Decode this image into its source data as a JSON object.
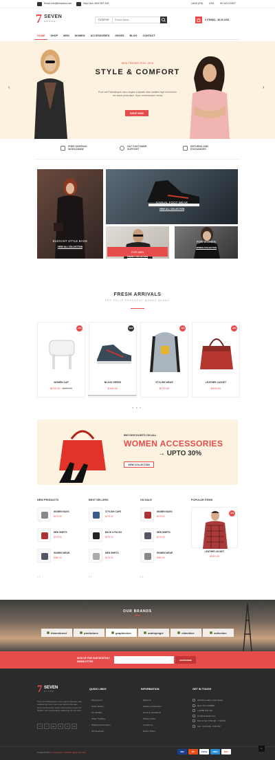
{
  "topbar": {
    "email": "Email: info@templaza.com",
    "phone": "Help Line: 0800 567 345",
    "language": "LANG (EN)",
    "currency": "USD",
    "account": "MY ACCOUNT"
  },
  "header": {
    "logo_mark": "7",
    "logo_name": "SEVEN",
    "logo_sub": "STORE",
    "filter_label": "FILTER BY",
    "search_placeholder": "Product Name...",
    "cart_label": "0 ITEM(S) - $0.00 USD"
  },
  "nav": [
    "HOME",
    "SHOP",
    "MEN",
    "WOMEN",
    "ACCESSORIES",
    "SHOES",
    "BLOG",
    "CONTACT"
  ],
  "hero": {
    "kicker": "NEW TRENDS 2015 - 2016",
    "title": "STYLE & COMFORT",
    "text": "Proin est Pellentesque risus magna vulputate vitae sodales eget enim lorem nec lacus porta diam. Nunc condimentum metus",
    "button": "SHOP NOW"
  },
  "services": [
    {
      "line1": "FREE SHIPPING",
      "line2": "WORLDWIDE"
    },
    {
      "line1": "24/7 CUSTOMER",
      "line2": "SUPPORT"
    },
    {
      "line1": "RETURNS AND",
      "line2": "EXCHANGES"
    }
  ],
  "collections": {
    "bags": {
      "title": "ELEGANT STYLE BAGS",
      "link": "VIEW ALL COLLECTION"
    },
    "shoes": {
      "title": "CASUAL FOOT WEAR",
      "link": "VIEW ALL COLLECTION"
    },
    "men": {
      "title": "FOR MEN",
      "link": "TRENDY COLLECTION"
    },
    "women": {
      "title": "FOR WOMEN",
      "link": "SPRING COLLECTION"
    }
  },
  "arrivals": {
    "title": "FRESH ARRIVALS",
    "subtitle": "SED FELIS PRAESENT DONEC BLAND",
    "products": [
      {
        "name": "WOMEN CAP",
        "price": "$240.00",
        "old": "$280.00",
        "badge": "-15%",
        "badge_color": "#e74c4c"
      },
      {
        "name": "BLACK DRESS",
        "price": "$160.00",
        "old": "",
        "badge": "NEW",
        "badge_color": "#333333"
      },
      {
        "name": "STYLISH WEAR",
        "price": "$175.00",
        "old": "",
        "badge": "-15%",
        "badge_color": "#e74c4c"
      },
      {
        "name": "LEATHER JACKET",
        "price": "$300.00",
        "old": "",
        "badge": "-20%",
        "badge_color": "#e74c4c"
      }
    ]
  },
  "promo": {
    "kicker": "BIG DISCOUNTS ON ALL",
    "title": "WOMEN ACCESSORIES",
    "offer": "→ UPTO 30%",
    "button": "VIEW COLLECTION"
  },
  "lists": [
    {
      "head": "NEW PRODUCTS",
      "items": [
        {
          "name": "WOMEN BAGS",
          "price": "$175.00"
        },
        {
          "name": "MEN SHIRTS",
          "price": "$175.00"
        },
        {
          "name": "WOMEN WEAR",
          "price": "$350.00"
        }
      ]
    },
    {
      "head": "BEST SELLERS",
      "items": [
        {
          "name": "STYLISH CAPS",
          "price": "$175.00"
        },
        {
          "name": "BACK & PACKS",
          "price": "$175.00"
        },
        {
          "name": "MEN SHIRTS",
          "price": "$175.00"
        }
      ]
    },
    {
      "head": "ON SALE",
      "items": [
        {
          "name": "WOMEN BAGS",
          "price": "$175.00"
        },
        {
          "name": "MEN SHIRTS",
          "price": "$175.00"
        },
        {
          "name": "WOMEN WEAR",
          "price": "$350.00"
        }
      ]
    }
  ],
  "popular": {
    "head": "POPULAR ITEMS",
    "name": "LEATHER JACKET",
    "price": "$320.00",
    "badge": "-20%"
  },
  "brands": {
    "title": "OUR BRANDS",
    "items": [
      "themeforest",
      "photodune",
      "graphicriver",
      "audiojungle",
      "videohive",
      "activeden"
    ]
  },
  "newsletter": {
    "label": "SIGN UP FOR OUR MONTHLY NEWSLETTER",
    "button": "SUBSCRIBE"
  },
  "footer": {
    "about": "Proin est Pellentesque risus magna vulputate vitae sodales eget enim lorem nec lacus porta diam. Nunc condimentum metus lorem eleifend nunc vel facilisis. Sed consectetuer adipiscing elit sed diam.",
    "quick_head": "QUICK LINKS",
    "quick": [
      "My Account",
      "Order History",
      "My Wishlist",
      "Order Tracking",
      "Shipping Information",
      "Gift Vouchers"
    ],
    "info_head": "INFORMATION",
    "info": [
      "About us",
      "Delivery Information",
      "Terms & Conditions",
      "Privacy Policy",
      "Contact us",
      "Return Policy"
    ],
    "contact_head": "GET IN TOUCH",
    "contact": [
      "25 Divine Hall, Lucas Street",
      "New York CO8888",
      "+1(088) 543 322",
      "info@templaza.com",
      "Mon to Sat: 8:00 AM - 7:00 PM",
      "Sun: 10:00 AM - 5:00 PM"
    ],
    "social": [
      "f",
      "t",
      "g+",
      "in",
      "p",
      "rss"
    ],
    "copyright": "Created PrW",
    "credit": "by TemplaZa © 2016 All rights reserved",
    "payments": [
      {
        "label": "VISA",
        "bg": "#1a3f8f",
        "fg": "#ffffff"
      },
      {
        "label": "MC",
        "bg": "#e8501a",
        "fg": "#ffffff"
      },
      {
        "label": "PayPal",
        "bg": "#ffffff",
        "fg": "#1a3f8f"
      },
      {
        "label": "AMEX",
        "bg": "#2a8fd8",
        "fg": "#ffffff"
      },
      {
        "label": "DISC",
        "bg": "#ffffff",
        "fg": "#e8501a"
      }
    ]
  },
  "colors": {
    "accent": "#e74c4c",
    "dark": "#2b2b2b",
    "cream": "#fdf1df"
  }
}
